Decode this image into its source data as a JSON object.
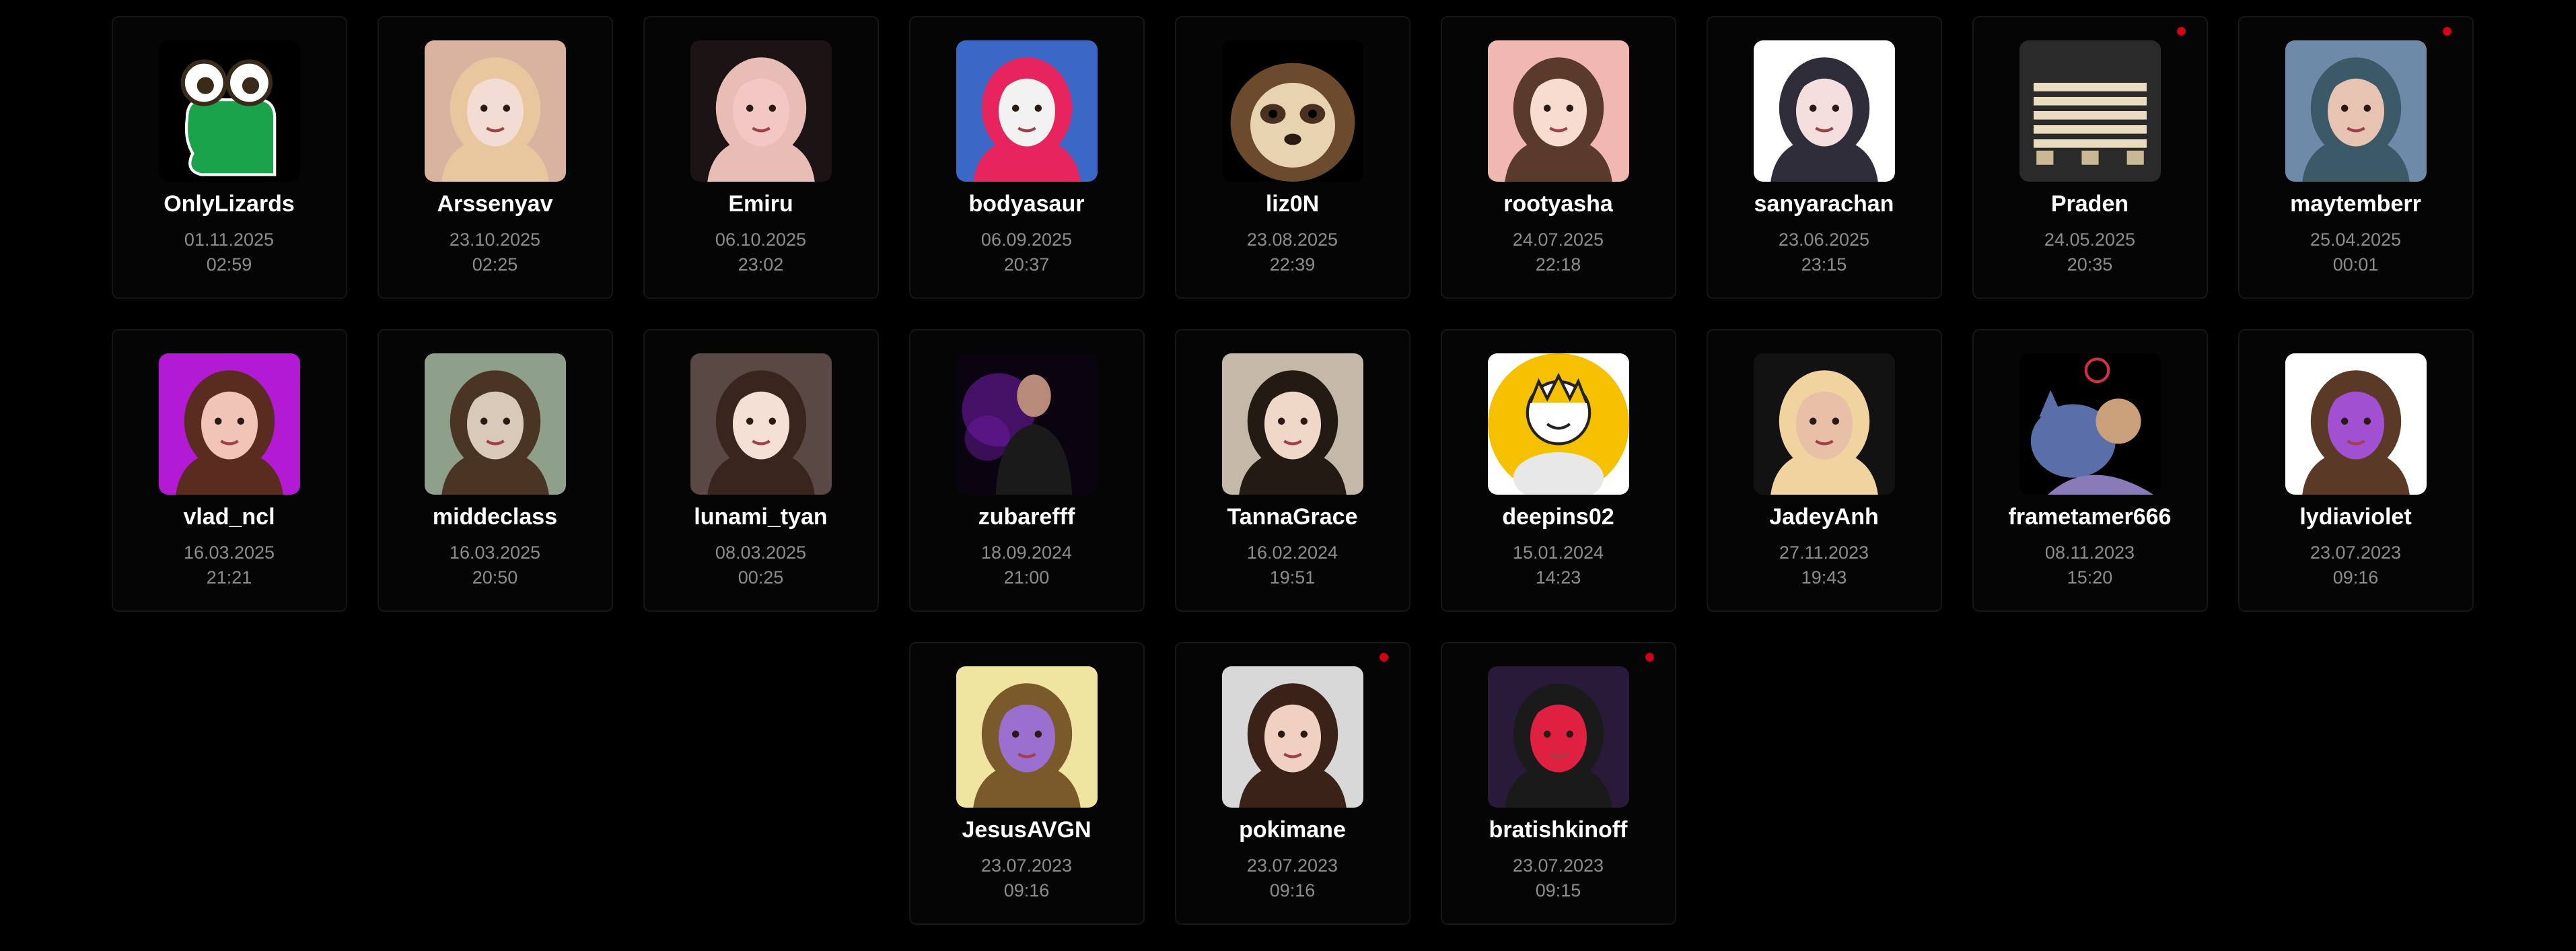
{
  "streamers": [
    {
      "name": "OnlyLizards",
      "date": "01.11.2025",
      "time": "02:59",
      "live": false,
      "avatar": "frog-cartoon",
      "colors": [
        "#000000",
        "#1aa34a",
        "#ffffff"
      ]
    },
    {
      "name": "Arssenyav",
      "date": "23.10.2025",
      "time": "02:25",
      "live": false,
      "avatar": "blonde-woman-photo",
      "colors": [
        "#d9b3a0",
        "#e9c79e",
        "#f3dcd4"
      ]
    },
    {
      "name": "Emiru",
      "date": "06.10.2025",
      "time": "23:02",
      "live": false,
      "avatar": "woman-face-closeup",
      "colors": [
        "#1c1414",
        "#e8bdb6",
        "#f2c7c4"
      ]
    },
    {
      "name": "bodyasaur",
      "date": "06.09.2025",
      "time": "20:37",
      "live": false,
      "avatar": "pink-balaclava-photo",
      "colors": [
        "#3b67c7",
        "#e8245e",
        "#f2f2f2"
      ]
    },
    {
      "name": "liz0N",
      "date": "23.08.2025",
      "time": "22:39",
      "live": false,
      "avatar": "pixel-sloth",
      "colors": [
        "#000000",
        "#6b4a2e",
        "#e8d3b0"
      ]
    },
    {
      "name": "rootyasha",
      "date": "24.07.2025",
      "time": "22:18",
      "live": false,
      "avatar": "anime-girl-headphones",
      "colors": [
        "#f0b8b0",
        "#5a3a2a",
        "#f7dccf"
      ]
    },
    {
      "name": "sanyarachan",
      "date": "23.06.2025",
      "time": "23:15",
      "live": false,
      "avatar": "anime-catgirl",
      "colors": [
        "#ffffff",
        "#2f2d3a",
        "#f5dede"
      ]
    },
    {
      "name": "Praden",
      "date": "24.05.2025",
      "time": "20:35",
      "live": true,
      "avatar": "wooden-pallet-photo",
      "colors": [
        "#2a2a2a",
        "#e9dcc0",
        "#c8b894"
      ]
    },
    {
      "name": "maytemberr",
      "date": "25.04.2025",
      "time": "00:01",
      "live": true,
      "avatar": "woman-blue-hair-photo",
      "colors": [
        "#6d8aa8",
        "#3c5968",
        "#e6c4b1"
      ]
    },
    {
      "name": "vlad_ncl",
      "date": "16.03.2025",
      "time": "21:21",
      "live": false,
      "avatar": "woman-glasses-photo",
      "colors": [
        "#b21bd3",
        "#5a2b1f",
        "#f0c5b8"
      ]
    },
    {
      "name": "middeclass",
      "date": "16.03.2025",
      "time": "20:50",
      "live": false,
      "avatar": "chimpanzee-photo",
      "colors": [
        "#8fa08a",
        "#4a3524",
        "#d9c9b8"
      ]
    },
    {
      "name": "lunami_tyan",
      "date": "08.03.2025",
      "time": "00:25",
      "live": false,
      "avatar": "anime-girl-glasses",
      "colors": [
        "#5a4845",
        "#3a241e",
        "#f5e0d6"
      ]
    },
    {
      "name": "zubarefff",
      "date": "18.09.2024",
      "time": "21:00",
      "live": false,
      "avatar": "man-purple-smoke-photo",
      "colors": [
        "#0a0310",
        "#6b1aa0",
        "#1a1a1a"
      ]
    },
    {
      "name": "TannaGrace",
      "date": "16.02.2024",
      "time": "19:51",
      "live": false,
      "avatar": "woman-dark-hair-photo",
      "colors": [
        "#c4b8a8",
        "#241a14",
        "#f0d8c8"
      ]
    },
    {
      "name": "deepins02",
      "date": "15.01.2024",
      "time": "14:23",
      "live": false,
      "avatar": "yellow-circle-drawing",
      "colors": [
        "#ffffff",
        "#f5c000",
        "#e8e8e8"
      ]
    },
    {
      "name": "JadeyAnh",
      "date": "27.11.2023",
      "time": "19:43",
      "live": false,
      "avatar": "blonde-woman-dark-photo",
      "colors": [
        "#121212",
        "#f0d39e",
        "#e8c0a8"
      ]
    },
    {
      "name": "frametamer666",
      "date": "08.11.2023",
      "time": "15:20",
      "live": false,
      "avatar": "man-and-wolf-drawing",
      "colors": [
        "#000000",
        "#5a6fa8",
        "#c9a07a"
      ]
    },
    {
      "name": "lydiaviolet",
      "date": "23.07.2023",
      "time": "09:16",
      "live": false,
      "avatar": "woman-purple-glove-photo",
      "colors": [
        "#ffffff",
        "#5a3a26",
        "#a050d0"
      ]
    },
    {
      "name": "JesusAVGN",
      "date": "23.07.2023",
      "time": "09:16",
      "live": false,
      "avatar": "bearded-man-drawing",
      "colors": [
        "#efe4a0",
        "#7a5a2a",
        "#9b6fd0"
      ]
    },
    {
      "name": "pokimane",
      "date": "23.07.2023",
      "time": "09:16",
      "live": true,
      "avatar": "woman-brown-hair-photo",
      "colors": [
        "#d8d8d8",
        "#3a2218",
        "#f0d0c0"
      ]
    },
    {
      "name": "bratishkinoff",
      "date": "23.07.2023",
      "time": "09:15",
      "live": true,
      "avatar": "man-tshirt-studio-photo",
      "colors": [
        "#2a1a3a",
        "#1a1a1a",
        "#e02040"
      ]
    }
  ]
}
